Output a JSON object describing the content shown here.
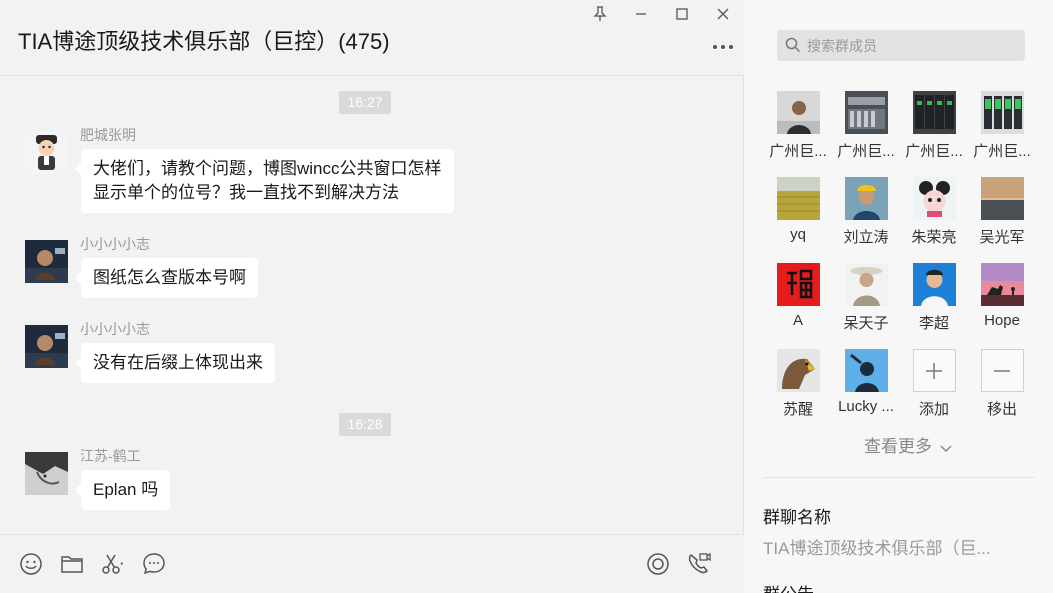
{
  "header": {
    "title": "TIA博途顶级技术俱乐部（巨控）(475)",
    "pin_icon": "pin-icon",
    "minimize_icon": "minimize-icon",
    "maximize_icon": "maximize-icon",
    "close_icon": "close-icon",
    "more_label": "..."
  },
  "messages": [
    {
      "type": "time",
      "text": "16:27"
    },
    {
      "type": "msg",
      "sender": "肥城张明",
      "lines": [
        "大佬们，请教个问题，博图wincc公共窗口怎样",
        "显示单个的位号？我一直找不到解决方法"
      ]
    },
    {
      "type": "msg",
      "sender": "小小小小志",
      "lines": [
        "图纸怎么查版本号啊"
      ]
    },
    {
      "type": "msg",
      "sender": "小小小小志",
      "lines": [
        "没有在后缀上体现出来"
      ]
    },
    {
      "type": "time",
      "text": "16:28"
    },
    {
      "type": "msg",
      "sender": "江苏-鹤工",
      "lines": [
        "Eplan 吗"
      ]
    }
  ],
  "toolbar": {
    "icons": [
      "emoji-icon",
      "folder-icon",
      "scissors-icon",
      "chat-bubble-icon",
      "live-icon",
      "video-call-icon"
    ]
  },
  "sidebar": {
    "search_placeholder": "搜索群成员",
    "members": [
      {
        "name": "广州巨..."
      },
      {
        "name": "广州巨..."
      },
      {
        "name": "广州巨..."
      },
      {
        "name": "广州巨..."
      },
      {
        "name": "yq"
      },
      {
        "name": "刘立涛"
      },
      {
        "name": "朱荣亮"
      },
      {
        "name": "吴光军"
      },
      {
        "name": "A"
      },
      {
        "name": "呆天子"
      },
      {
        "name": "李超"
      },
      {
        "name": "Hope"
      },
      {
        "name": "苏醒"
      },
      {
        "name": "Lucky ..."
      }
    ],
    "add_label": "添加",
    "remove_label": "移出",
    "see_more": "查看更多",
    "group_name_title": "群聊名称",
    "group_name_value": "TIA博途顶级技术俱乐部（巨...",
    "announcement_title": "群公告"
  }
}
